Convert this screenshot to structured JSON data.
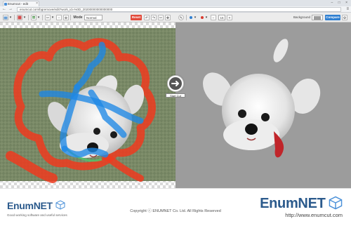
{
  "browser": {
    "tab_title": "Enumcut - edit",
    "tab_close": "×",
    "window_controls": "– □ ×",
    "back": "←",
    "forward": "→",
    "url": "enumcut.com/bgremove/edit?work_id=%0D_20200000000000000",
    "menu": "≡"
  },
  "toolbar": {
    "mode_label": "Mode",
    "mode_value": "Normal",
    "reset_label": "Reset",
    "brush_size": "15",
    "background_label": "Background",
    "compare_label": "Compare",
    "accent_color": "#e24b3c",
    "compare_color": "#2f7fd1",
    "keep_color": "#2fa84f",
    "remove_color": "#d93a2f"
  },
  "canvas": {
    "start_cut_label": "Start Cut",
    "right_bg_color": "#9c9c9c"
  },
  "footer": {
    "left_logo": "EnumNET",
    "left_tagline": "Good working software and useful services",
    "copyright": "Copyright ⓒ ENUMNET Co. Ltd. All Rights Reserved",
    "right_logo": "EnumNET",
    "right_url": "http://www.enumcut.com"
  }
}
